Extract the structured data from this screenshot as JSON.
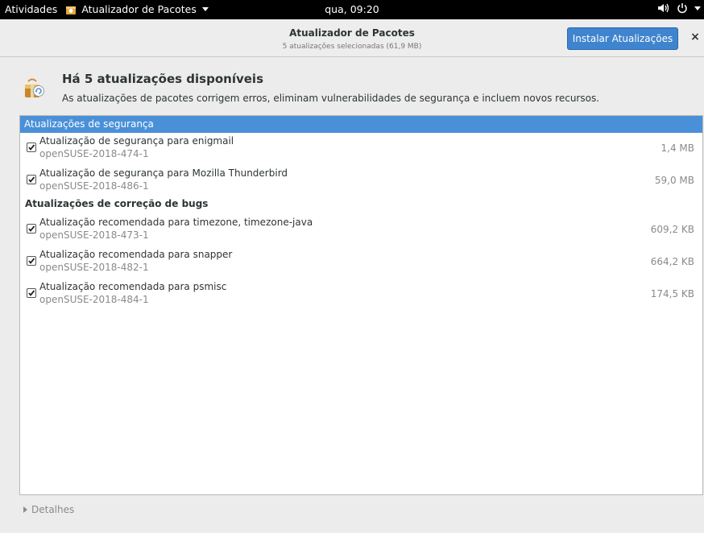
{
  "topbar": {
    "activities": "Atividades",
    "app_menu": "Atualizador de Pacotes",
    "clock": "qua, 09:20"
  },
  "headerbar": {
    "title": "Atualizador de Pacotes",
    "subtitle": "5 atualizações selecionadas (61,9 MB)",
    "install_label": "Instalar Atualizações",
    "close_label": "×"
  },
  "info": {
    "title": "Há 5 atualizações disponíveis",
    "description": "As atualizações de pacotes corrigem erros, eliminam vulnerabilidades de segurança e incluem novos recursos."
  },
  "security": {
    "header": "Atualizações de segurança",
    "items": [
      {
        "title": "Atualização de segurança para enigmail",
        "id": "openSUSE-2018-474-1",
        "size": "1,4 MB",
        "checked": true
      },
      {
        "title": "Atualização de segurança para Mozilla Thunderbird",
        "id": "openSUSE-2018-486-1",
        "size": "59,0 MB",
        "checked": true
      }
    ]
  },
  "bugfix": {
    "header": "Atualizações de correção de bugs",
    "items": [
      {
        "title": "Atualização recomendada para timezone, timezone-java",
        "id": "openSUSE-2018-473-1",
        "size": "609,2 KB",
        "checked": true
      },
      {
        "title": "Atualização recomendada para snapper",
        "id": "openSUSE-2018-482-1",
        "size": "664,2 KB",
        "checked": true
      },
      {
        "title": "Atualização recomendada para psmisc",
        "id": "openSUSE-2018-484-1",
        "size": "174,5 KB",
        "checked": true
      }
    ]
  },
  "details": {
    "label": "Detalhes"
  },
  "colors": {
    "accent": "#4a90d9",
    "install_button": "#3f84ce",
    "topbar": "#000000"
  }
}
